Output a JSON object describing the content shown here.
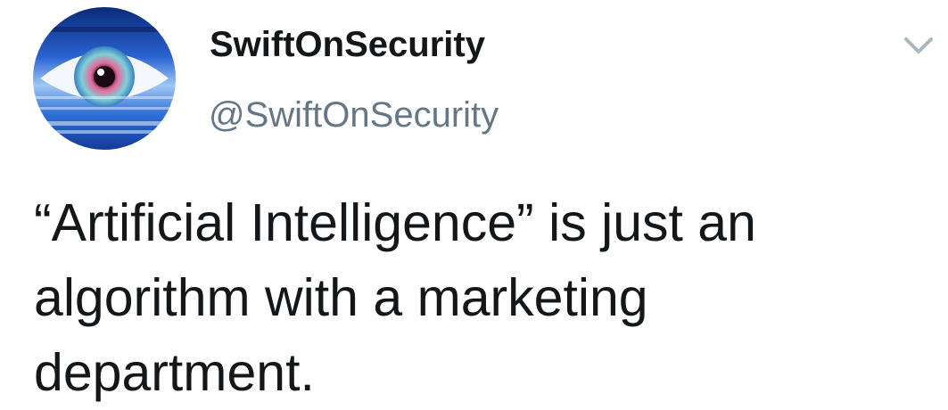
{
  "tweet": {
    "author": {
      "display_name": "SwiftOnSecurity",
      "handle": "@SwiftOnSecurity",
      "avatar_icon": "eye-icon"
    },
    "text": "“Artificial Intelligence” is just an algorithm with a marketing department.",
    "menu_icon": "chevron-down-icon"
  },
  "colors": {
    "text_primary": "#14171a",
    "text_secondary": "#657786",
    "chevron": "#aab8c2",
    "avatar_blue": "#1f4fb0",
    "avatar_iris": "#e46a9a"
  }
}
